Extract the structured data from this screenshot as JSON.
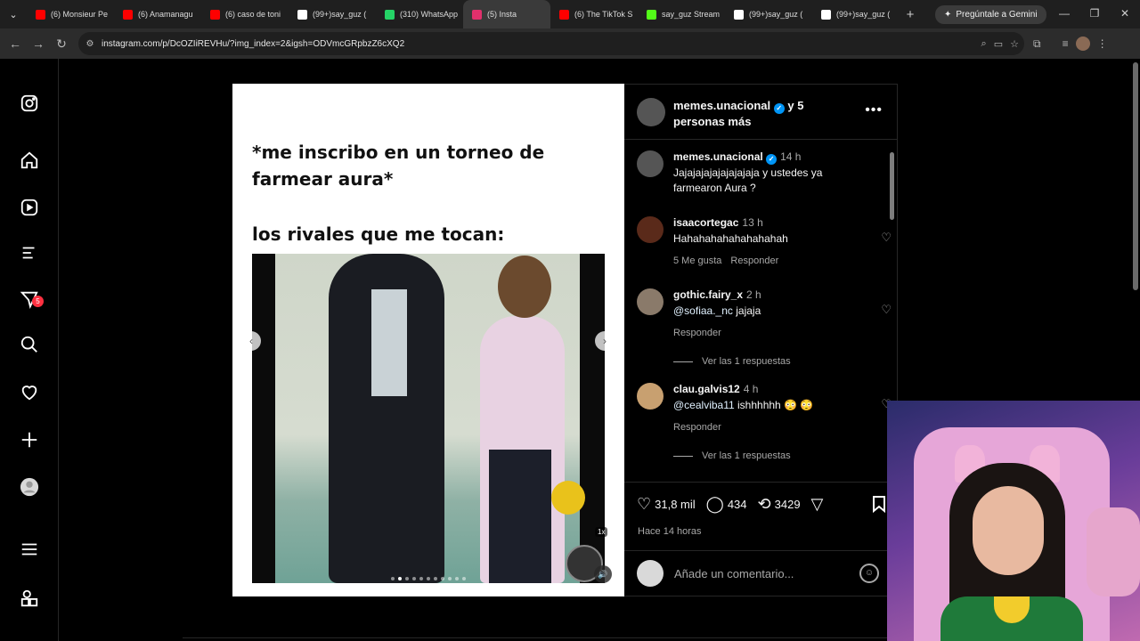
{
  "browser": {
    "tabs": [
      {
        "title": "(6) Monsieur Pe",
        "color": "#ff0000"
      },
      {
        "title": "(6) Anamanagu",
        "color": "#ff0000"
      },
      {
        "title": "(6) caso de toni",
        "color": "#ff0000"
      },
      {
        "title": "(99+)say_guz (",
        "color": "#ffffff"
      },
      {
        "title": "(310) WhatsApp",
        "color": "#25d366"
      },
      {
        "title": "(5) Insta",
        "color": "#e1306c",
        "active": true
      },
      {
        "title": "(6) The TikTok S",
        "color": "#ff0000"
      },
      {
        "title": "say_guz Stream",
        "color": "#53fc18"
      },
      {
        "title": "(99+)say_guz (",
        "color": "#ffffff"
      },
      {
        "title": "(99+)say_guz (",
        "color": "#ffffff"
      }
    ],
    "gemini_label": "Pregúntale a Gemini",
    "url": "instagram.com/p/DcOZIiREVHu/?img_index=2&igsh=ODVmcGRpbzZ6cXQ2"
  },
  "sidenav": {
    "notifications_badge": "5"
  },
  "post": {
    "meme_line1": "*me inscribo en un torneo de",
    "meme_line2": "farmear aura*",
    "meme_line3": "los rivales que me tocan:",
    "speed_label": "1x",
    "header_name": "memes.unacional",
    "header_suffix": "y 5 personas más",
    "caption": {
      "user": "memes.unacional",
      "time": "14 h",
      "text": "Jajajajajajajajajaja y ustedes ya farmearon Aura ?"
    },
    "comments": [
      {
        "user": "isaacortegac",
        "time": "13 h",
        "text": "Hahahahahahahahahah",
        "likes": "5 Me gusta",
        "reply": "Responder",
        "avatar_color": "#5a2a1a"
      },
      {
        "user": "gothic.fairy_x",
        "time": "2 h",
        "mention": "@sofiaa._nc",
        "text": "jajaja",
        "reply": "Responder",
        "view_replies": "Ver las 1 respuestas",
        "avatar_color": "#8a7a6a"
      },
      {
        "user": "clau.galvis12",
        "time": "4 h",
        "mention": "@cealviba11",
        "text": "ishhhhhh 😳 😳",
        "reply": "Responder",
        "view_replies": "Ver las 1 respuestas",
        "avatar_color": "#c8a070"
      }
    ],
    "likes": "31,8 mil",
    "comments_count": "434",
    "reposts": "3429",
    "time_ago": "Hace 14 horas",
    "add_comment_placeholder": "Añade un comentario..."
  },
  "colors": {
    "accent": "#0095f6",
    "badge": "#ff3040"
  }
}
